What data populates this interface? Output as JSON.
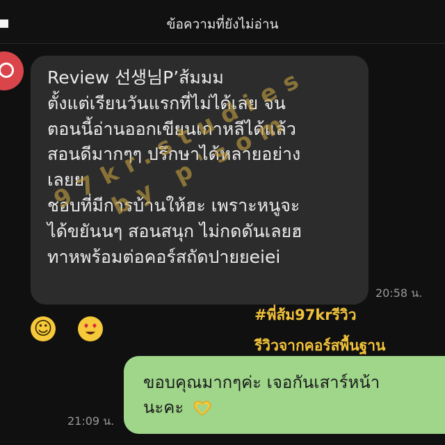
{
  "header": {
    "title": "ข้อความที่ยังไม่อ่าน"
  },
  "incoming_message": {
    "lines": [
      "Review 선생님P’ส้มมม",
      "ตั้งแต่เรียนวันแรกที่ไม่ได้เลย จน",
      "ตอนนี้อ่านออกเขียนเกาหลีได้แล้ว",
      "สอนดีมากๆๆ ปรึกษาได้หลายอย่าง",
      "เลยย",
      "ชอบที่มีการบ้านให้ฮะ เพราะหนูจะ",
      "ได้ขยันนๆ  สอนสนุก ไม่กดดันเลยฮ",
      "ทาหพร้อมต่อคอร์สถัดปายยeiei"
    ],
    "time": "20:58 น.",
    "reactions": [
      "smile-emoji",
      "heart-eyes-emoji"
    ]
  },
  "overlay": {
    "hashtag": "#พี่ส้ม97krรีวิว",
    "subtitle": "รีวิวจากคอร์สพื้นฐาน",
    "watermark_line1": "97kr.studies",
    "watermark_line2": "by p'som"
  },
  "outgoing_message": {
    "lines": [
      "ขอบคุณมากๆค่ะ เจอกันเสาร์หน้า",
      "นะคะ"
    ],
    "emoji": "heart-hands-emoji",
    "time": "21:09 น."
  },
  "colors": {
    "background": "#101010",
    "incoming_bubble": "#2c2c2c",
    "outgoing_bubble": "#9fd68a",
    "accent_text": "#f2c23a",
    "avatar": "#d9454a"
  }
}
